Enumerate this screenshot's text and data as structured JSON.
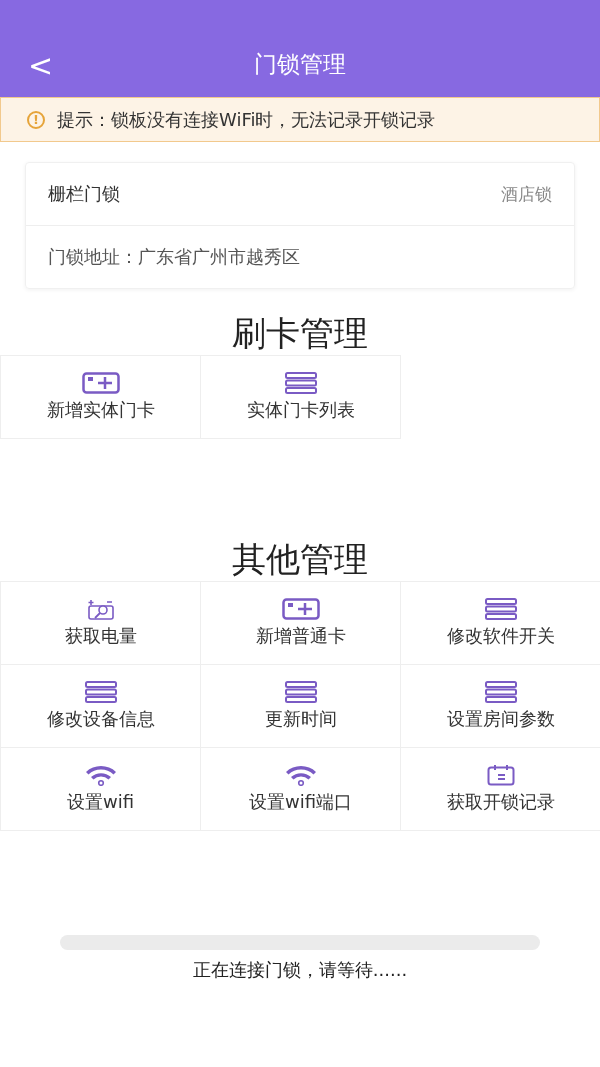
{
  "header": {
    "back": "<",
    "title": "门锁管理"
  },
  "notice": {
    "icon": "!",
    "text": "提示：锁板没有连接WiFi时，无法记录开锁记录"
  },
  "lock": {
    "name": "栅栏门锁",
    "type": "酒店锁",
    "address": "门锁地址：广东省广州市越秀区"
  },
  "sections": [
    {
      "title": "刷卡管理",
      "items": [
        {
          "kind": "card",
          "label": "新增实体门卡"
        },
        {
          "kind": "list",
          "label": "实体门卡列表"
        }
      ]
    },
    {
      "title": "其他管理",
      "items": [
        {
          "kind": "battery",
          "label": "获取电量"
        },
        {
          "kind": "card",
          "label": "新增普通卡"
        },
        {
          "kind": "list",
          "label": "修改软件开关"
        },
        {
          "kind": "list",
          "label": "修改设备信息"
        },
        {
          "kind": "list",
          "label": "更新时间"
        },
        {
          "kind": "list",
          "label": "设置房间参数"
        },
        {
          "kind": "wifi",
          "label": "设置wifi"
        },
        {
          "kind": "wifi",
          "label": "设置wifi端口"
        },
        {
          "kind": "calendar",
          "label": "获取开锁记录"
        }
      ]
    }
  ],
  "progress": {
    "level": 0,
    "text": "正在连接门锁，请等待......"
  }
}
